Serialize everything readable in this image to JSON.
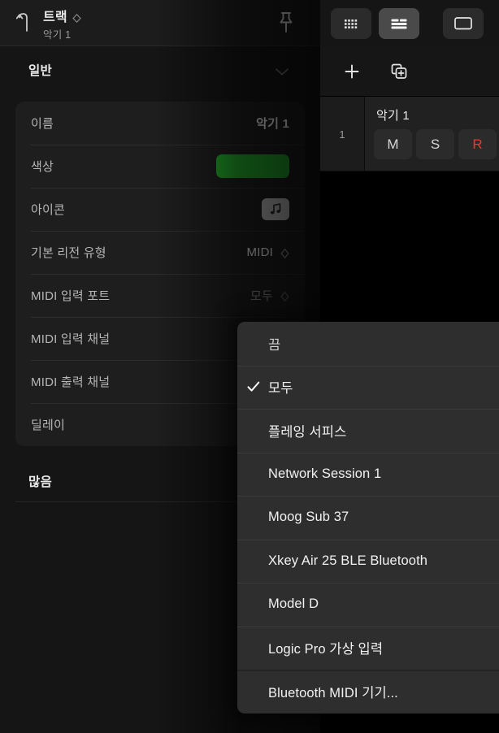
{
  "colors": {
    "accent_green": "#22a52a",
    "record_red": "#e8392b",
    "panel_bg": "#151515",
    "card_bg": "#1e1e1e",
    "menu_bg": "#2e2e2e"
  },
  "inspector": {
    "header": {
      "back_icon": "arrow-up-left-icon",
      "title": "트랙",
      "subtitle": "악기 1",
      "stepper_icon": "stepper-diamond-icon",
      "pin_icon": "pin-icon"
    },
    "sections": [
      {
        "title": "일반",
        "chevron_icon": "chevron-down-icon"
      },
      {
        "title": "많음"
      }
    ],
    "rows": [
      {
        "label": "이름",
        "value": "악기 1",
        "type": "text-bold"
      },
      {
        "label": "색상",
        "value": "",
        "type": "color-swatch"
      },
      {
        "label": "아이콘",
        "value": "",
        "type": "icon-swatch",
        "icon": "music-note-icon"
      },
      {
        "label": "기본 리전 유형",
        "value": "MIDI",
        "type": "stepper"
      },
      {
        "label": "MIDI 입력 포트",
        "value": "모두",
        "type": "stepper-dim"
      },
      {
        "label": "MIDI 입력 채널",
        "value": "",
        "type": "hidden"
      },
      {
        "label": "MIDI 출력 채널",
        "value": "",
        "type": "hidden"
      },
      {
        "label": "딜레이",
        "value": "",
        "type": "ghost-field"
      }
    ]
  },
  "arrange": {
    "toolbar": [
      {
        "name": "grid-view-button",
        "icon": "grid-icon",
        "active": false
      },
      {
        "name": "list-view-button",
        "icon": "list-icon",
        "active": true
      },
      {
        "name": "window-view-button",
        "icon": "rectangle-icon",
        "active": false
      }
    ],
    "subtoolbar": [
      {
        "name": "add-track-button",
        "icon": "plus-icon"
      },
      {
        "name": "duplicate-track-button",
        "icon": "duplicate-plus-icon"
      }
    ],
    "track": {
      "number": "1",
      "name": "악기 1",
      "buttons": [
        {
          "label": "M",
          "name": "mute-button"
        },
        {
          "label": "S",
          "name": "solo-button"
        },
        {
          "label": "R",
          "name": "record-enable-button"
        }
      ]
    }
  },
  "menu": {
    "items": [
      {
        "label": "끔",
        "checked": false,
        "dim": true
      },
      {
        "label": "모두",
        "checked": true,
        "dim": false
      },
      {
        "label": "플레잉 서피스",
        "checked": false,
        "dim": false
      },
      {
        "label": "Network Session 1",
        "checked": false,
        "dim": false
      },
      {
        "label": "Moog Sub 37",
        "checked": false,
        "dim": false
      },
      {
        "label": "Xkey Air 25 BLE Bluetooth",
        "checked": false,
        "dim": false
      },
      {
        "label": "Model D",
        "checked": false,
        "dim": false
      },
      {
        "label": "Logic Pro 가상 입력",
        "checked": false,
        "dim": false
      },
      {
        "label": "Bluetooth MIDI 기기...",
        "checked": false,
        "dim": false,
        "separator_strong": true
      }
    ]
  }
}
